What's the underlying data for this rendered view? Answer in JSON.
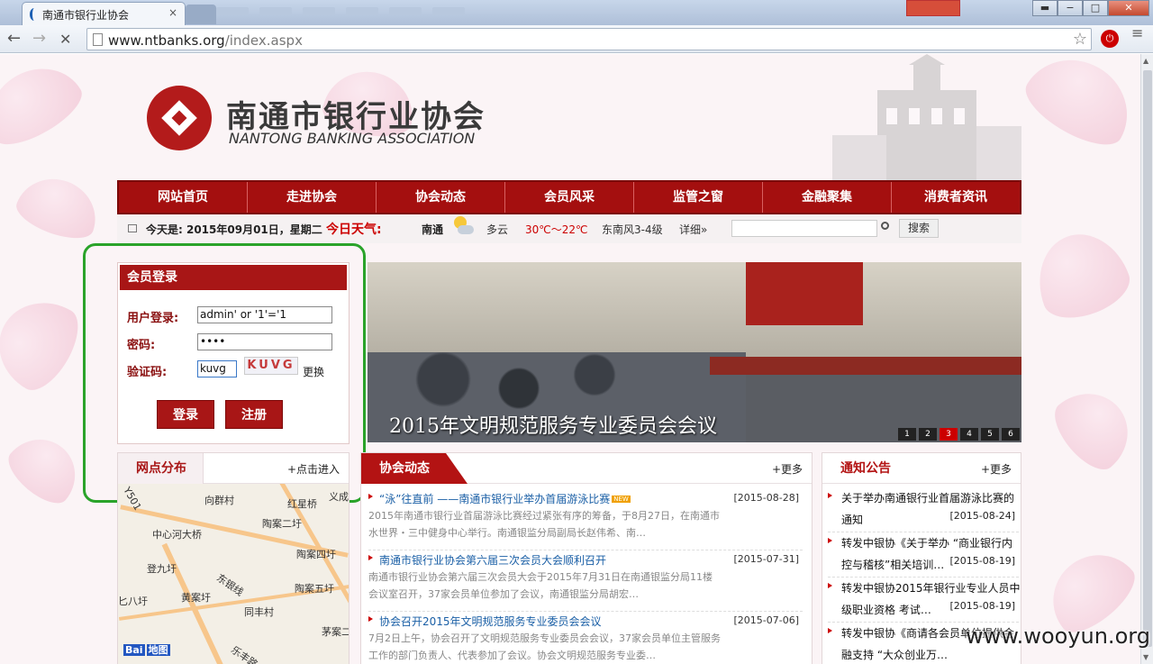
{
  "browser": {
    "tab_title": "南通市银行业协会",
    "tab_close": "×",
    "url_domain": "www.ntbanks.org",
    "url_path": "/index.aspx",
    "back_icon": "←",
    "forward_icon": "→",
    "reload_icon": "✕",
    "star_icon": "☆",
    "minimize": "−",
    "maximize": "□",
    "close": "✕",
    "ext_icon_text": "⏻",
    "menu_icon": "≡"
  },
  "header": {
    "title": "南通市银行业协会",
    "subtitle": "NANTONG BANKING ASSOCIATION"
  },
  "nav": {
    "items": [
      "网站首页",
      "走进协会",
      "协会动态",
      "会员风采",
      "监管之窗",
      "金融聚集",
      "消费者资讯"
    ]
  },
  "infobar": {
    "date": "今天是: 2015年09月01日，星期二",
    "weather_label": "今日天气:",
    "city": "南通",
    "condition": "多云",
    "temperature": "30℃～22℃",
    "wind": "东南风3-4级",
    "detail": "详细»",
    "search_button": "搜索"
  },
  "login": {
    "heading": "会员登录",
    "username_label": "用户登录:",
    "username_value": "admin' or '1'='1",
    "password_label": "密码:",
    "password_value": "••••",
    "captcha_label": "验证码:",
    "captcha_value": "kuvg",
    "captcha_image_text": "KUVG",
    "refresh": "更换",
    "login_button": "登录",
    "register_button": "注册"
  },
  "slideshow": {
    "caption": "2015年文明规范服务专业委员会会议",
    "pages": [
      "1",
      "2",
      "3",
      "4",
      "5",
      "6"
    ],
    "active_page": 3
  },
  "map_panel": {
    "title": "网点分布",
    "more": "+点击进入",
    "labels": [
      "向群村",
      "红星桥",
      "义成",
      "陶案二圩",
      "中心河大桥",
      "陶案四圩",
      "登九圩",
      "东银线",
      "陶案五圩",
      "黄案圩",
      "同丰村",
      "茅案二",
      "乐丰路",
      "Y501",
      "匕八圩"
    ],
    "brand": "Bai",
    "brand_suffix": "地图"
  },
  "news": {
    "title": "协会动态",
    "more": "+更多",
    "items": [
      {
        "title": "“泳”往直前 ——南通市银行业举办首届游泳比赛",
        "badge": "NEW",
        "date": "[2015-08-28]",
        "summary": "2015年南通市银行业首届游泳比赛经过紧张有序的筹备，于8月27日，在南通市水世界・三中健身中心举行。南通银监分局副局长赵伟希、南…"
      },
      {
        "title": "南通市银行业协会第六届三次会员大会顺利召开",
        "badge": "",
        "date": "[2015-07-31]",
        "summary": "南通市银行业协会第六届三次会员大会于2015年7月31日在南通银监分局11楼会议室召开，37家会员单位参加了会议，南通银监分局胡宏…"
      },
      {
        "title": "协会召开2015年文明规范服务专业委员会会议",
        "badge": "",
        "date": "[2015-07-06]",
        "summary": "7月2日上午，协会召开了文明规范服务专业委员会会议，37家会员单位主管服务工作的部门负责人、代表参加了会议。协会文明规范服务专业委…"
      }
    ]
  },
  "notices": {
    "title": "通知公告",
    "more": "+更多",
    "items": [
      {
        "title": "关于举办南通银行业首届游泳比赛的通知",
        "date": "[2015-08-24]"
      },
      {
        "title": "转发中银协《关于举办 “商业银行内控与稽核”相关培训…",
        "date": "[2015-08-19]"
      },
      {
        "title": "转发中银协2015年银行业专业人员中级职业资格 考试…",
        "date": "[2015-08-19]"
      },
      {
        "title": "转发中银协《商请各会员单位提供金融支持 “大众创业万…",
        "date": ""
      }
    ]
  },
  "watermark": "www.wooyun.org",
  "colors": {
    "brand_red": "#a40f0f",
    "highlight_green": "#2aa32a",
    "link_blue": "#1a5fa6"
  }
}
